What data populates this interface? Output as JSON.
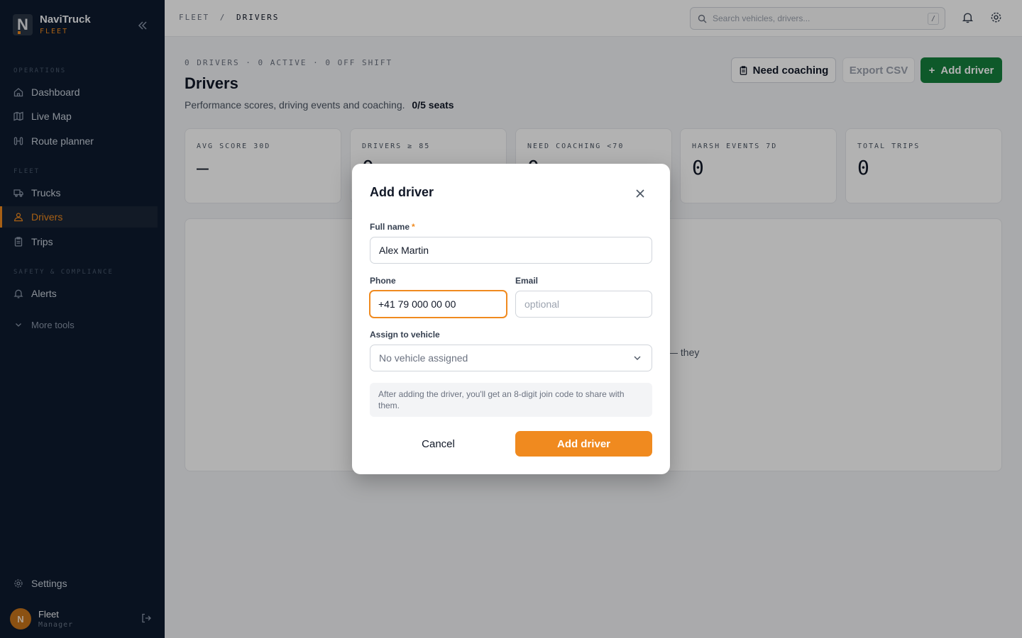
{
  "sidebar": {
    "brand": {
      "name": "NaviTruck",
      "sub": "FLEET",
      "logo_letter": "N"
    },
    "sections": {
      "operations": "OPERATIONS",
      "fleet": "FLEET",
      "safety": "SAFETY & COMPLIANCE"
    },
    "items": {
      "dashboard": "Dashboard",
      "live_map": "Live Map",
      "route_planner": "Route planner",
      "trucks": "Trucks",
      "drivers": "Drivers",
      "trips": "Trips",
      "alerts": "Alerts",
      "more_tools": "More tools",
      "settings": "Settings"
    },
    "active_item": "Drivers",
    "user": {
      "initial": "N",
      "name": "Fleet",
      "role": "Manager"
    }
  },
  "topbar": {
    "breadcrumb": {
      "parent": "FLEET",
      "separator": "/",
      "current": "DRIVERS"
    },
    "search": {
      "placeholder": "Search vehicles, drivers...",
      "shortcut": "/"
    },
    "icons": [
      "bell-icon",
      "gear-icon"
    ]
  },
  "page": {
    "summary": "0 DRIVERS · 0 ACTIVE · 0 OFF SHIFT",
    "title": "Drivers",
    "description": "Performance scores, driving events and coaching.",
    "seats": "0/5 seats",
    "actions": {
      "coaching": "Need coaching",
      "export": "Export CSV",
      "add": "Add driver"
    },
    "stats": [
      {
        "label": "AVG SCORE 30D",
        "value": "—"
      },
      {
        "label": "DRIVERS ≥ 85",
        "value": "0"
      },
      {
        "label": "NEED COACHING <70",
        "value": "0"
      },
      {
        "label": "HARSH EVENTS 7D",
        "value": "0"
      },
      {
        "label": "TOTAL TRIPS",
        "value": "0"
      }
    ],
    "empty_fragment": "— they"
  },
  "modal": {
    "title": "Add driver",
    "full_name": {
      "label": "Full name",
      "required_mark": "*",
      "value": "Alex Martin"
    },
    "phone": {
      "label": "Phone",
      "value": "+41 79 000 00 00"
    },
    "email": {
      "label": "Email",
      "value": "",
      "placeholder": "optional"
    },
    "vehicle": {
      "label": "Assign to vehicle",
      "selected": "No vehicle assigned"
    },
    "hint": "After adding the driver, you'll get an 8-digit join code to share with them.",
    "cancel": "Cancel",
    "submit": "Add driver"
  },
  "colors": {
    "sidebar_bg": "#0d1a2e",
    "accent": "#f08a1f",
    "primary_green": "#15803d",
    "overlay": "rgba(0,0,0,0.30)"
  }
}
